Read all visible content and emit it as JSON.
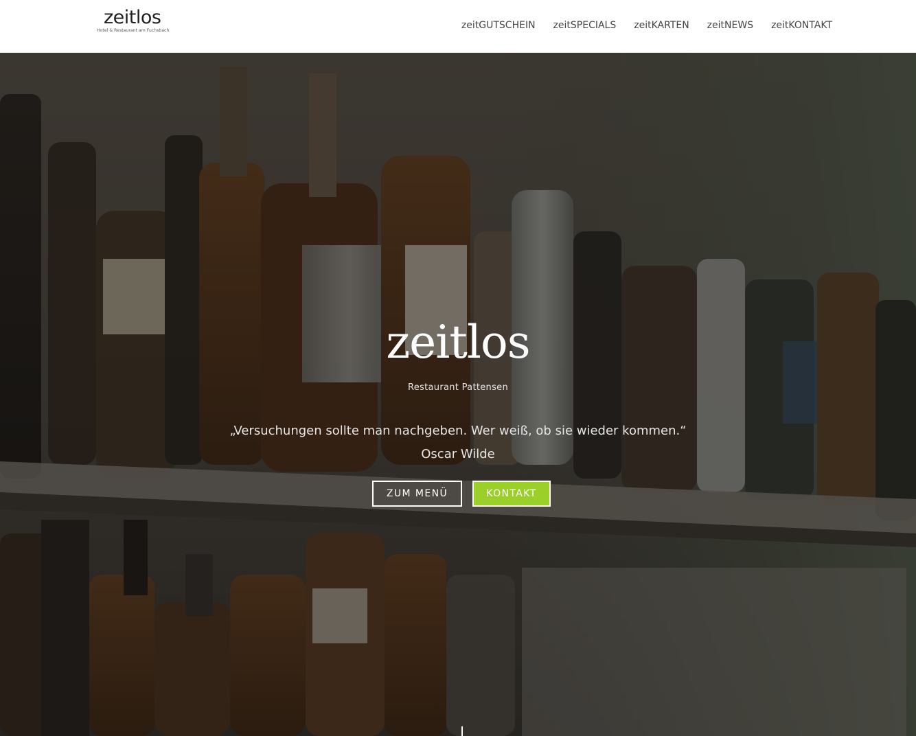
{
  "header": {
    "logo": {
      "name": "zeitlos",
      "tagline": "Hotel & Restaurant am Fuchsbach"
    },
    "nav": [
      {
        "label": "zeitGUTSCHEIN"
      },
      {
        "label": "zeitSPECIALS"
      },
      {
        "label": "zeitKARTEN"
      },
      {
        "label": "zeitNEWS"
      },
      {
        "label": "zeitKONTAKT"
      }
    ]
  },
  "hero": {
    "title": "zeitlos",
    "subtitle": "Restaurant Pattensen",
    "quote": "„Versuchungen sollte man nachgeben. Wer weiß, ob sie wieder kommen.“",
    "author": "Oscar Wilde",
    "buttons": {
      "menu_label": "ZUM MENÜ",
      "contact_label": "KONTAKT"
    }
  },
  "colors": {
    "accent": "#9bd02a",
    "nav_text": "#444444",
    "header_bg": "#ffffff",
    "hero_overlay": "#12100e"
  }
}
